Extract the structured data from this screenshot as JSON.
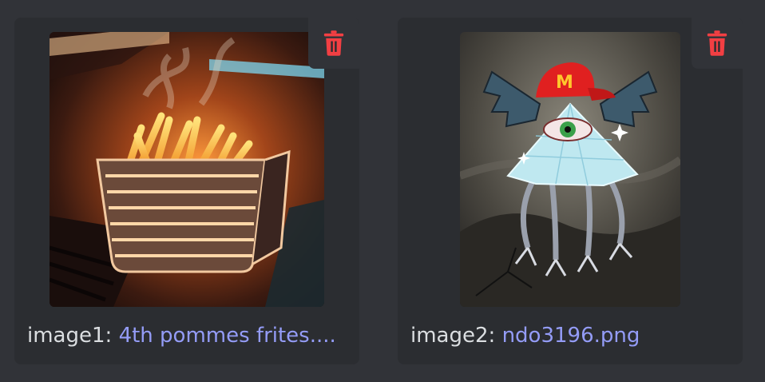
{
  "attachments": [
    {
      "label": "image1:",
      "filename": "4th pommes frites....",
      "alt": "fries in a glowing wire basket"
    },
    {
      "label": "image2:",
      "filename": "ndo3196.png",
      "alt": "winged eye pyramid creature with red cap"
    }
  ],
  "colors": {
    "delete_icon": "#f23f43",
    "link": "#949cf7",
    "card_bg": "#2b2d31",
    "page_bg": "#313338"
  },
  "icons": {
    "delete": "trash-icon"
  }
}
